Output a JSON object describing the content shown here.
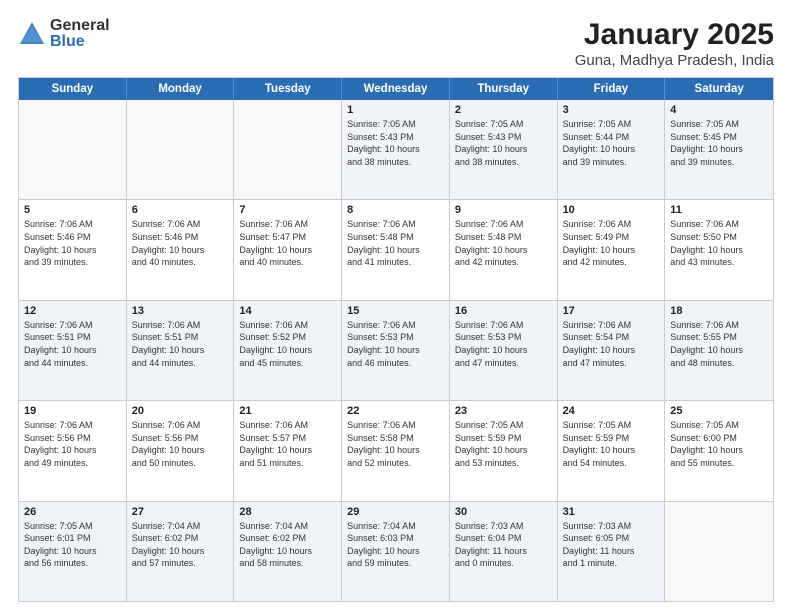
{
  "logo": {
    "general": "General",
    "blue": "Blue"
  },
  "title": "January 2025",
  "subtitle": "Guna, Madhya Pradesh, India",
  "header_days": [
    "Sunday",
    "Monday",
    "Tuesday",
    "Wednesday",
    "Thursday",
    "Friday",
    "Saturday"
  ],
  "rows": [
    [
      {
        "day": "",
        "info": ""
      },
      {
        "day": "",
        "info": ""
      },
      {
        "day": "",
        "info": ""
      },
      {
        "day": "1",
        "info": "Sunrise: 7:05 AM\nSunset: 5:43 PM\nDaylight: 10 hours\nand 38 minutes."
      },
      {
        "day": "2",
        "info": "Sunrise: 7:05 AM\nSunset: 5:43 PM\nDaylight: 10 hours\nand 38 minutes."
      },
      {
        "day": "3",
        "info": "Sunrise: 7:05 AM\nSunset: 5:44 PM\nDaylight: 10 hours\nand 39 minutes."
      },
      {
        "day": "4",
        "info": "Sunrise: 7:05 AM\nSunset: 5:45 PM\nDaylight: 10 hours\nand 39 minutes."
      }
    ],
    [
      {
        "day": "5",
        "info": "Sunrise: 7:06 AM\nSunset: 5:46 PM\nDaylight: 10 hours\nand 39 minutes."
      },
      {
        "day": "6",
        "info": "Sunrise: 7:06 AM\nSunset: 5:46 PM\nDaylight: 10 hours\nand 40 minutes."
      },
      {
        "day": "7",
        "info": "Sunrise: 7:06 AM\nSunset: 5:47 PM\nDaylight: 10 hours\nand 40 minutes."
      },
      {
        "day": "8",
        "info": "Sunrise: 7:06 AM\nSunset: 5:48 PM\nDaylight: 10 hours\nand 41 minutes."
      },
      {
        "day": "9",
        "info": "Sunrise: 7:06 AM\nSunset: 5:48 PM\nDaylight: 10 hours\nand 42 minutes."
      },
      {
        "day": "10",
        "info": "Sunrise: 7:06 AM\nSunset: 5:49 PM\nDaylight: 10 hours\nand 42 minutes."
      },
      {
        "day": "11",
        "info": "Sunrise: 7:06 AM\nSunset: 5:50 PM\nDaylight: 10 hours\nand 43 minutes."
      }
    ],
    [
      {
        "day": "12",
        "info": "Sunrise: 7:06 AM\nSunset: 5:51 PM\nDaylight: 10 hours\nand 44 minutes."
      },
      {
        "day": "13",
        "info": "Sunrise: 7:06 AM\nSunset: 5:51 PM\nDaylight: 10 hours\nand 44 minutes."
      },
      {
        "day": "14",
        "info": "Sunrise: 7:06 AM\nSunset: 5:52 PM\nDaylight: 10 hours\nand 45 minutes."
      },
      {
        "day": "15",
        "info": "Sunrise: 7:06 AM\nSunset: 5:53 PM\nDaylight: 10 hours\nand 46 minutes."
      },
      {
        "day": "16",
        "info": "Sunrise: 7:06 AM\nSunset: 5:53 PM\nDaylight: 10 hours\nand 47 minutes."
      },
      {
        "day": "17",
        "info": "Sunrise: 7:06 AM\nSunset: 5:54 PM\nDaylight: 10 hours\nand 47 minutes."
      },
      {
        "day": "18",
        "info": "Sunrise: 7:06 AM\nSunset: 5:55 PM\nDaylight: 10 hours\nand 48 minutes."
      }
    ],
    [
      {
        "day": "19",
        "info": "Sunrise: 7:06 AM\nSunset: 5:56 PM\nDaylight: 10 hours\nand 49 minutes."
      },
      {
        "day": "20",
        "info": "Sunrise: 7:06 AM\nSunset: 5:56 PM\nDaylight: 10 hours\nand 50 minutes."
      },
      {
        "day": "21",
        "info": "Sunrise: 7:06 AM\nSunset: 5:57 PM\nDaylight: 10 hours\nand 51 minutes."
      },
      {
        "day": "22",
        "info": "Sunrise: 7:06 AM\nSunset: 5:58 PM\nDaylight: 10 hours\nand 52 minutes."
      },
      {
        "day": "23",
        "info": "Sunrise: 7:05 AM\nSunset: 5:59 PM\nDaylight: 10 hours\nand 53 minutes."
      },
      {
        "day": "24",
        "info": "Sunrise: 7:05 AM\nSunset: 5:59 PM\nDaylight: 10 hours\nand 54 minutes."
      },
      {
        "day": "25",
        "info": "Sunrise: 7:05 AM\nSunset: 6:00 PM\nDaylight: 10 hours\nand 55 minutes."
      }
    ],
    [
      {
        "day": "26",
        "info": "Sunrise: 7:05 AM\nSunset: 6:01 PM\nDaylight: 10 hours\nand 56 minutes."
      },
      {
        "day": "27",
        "info": "Sunrise: 7:04 AM\nSunset: 6:02 PM\nDaylight: 10 hours\nand 57 minutes."
      },
      {
        "day": "28",
        "info": "Sunrise: 7:04 AM\nSunset: 6:02 PM\nDaylight: 10 hours\nand 58 minutes."
      },
      {
        "day": "29",
        "info": "Sunrise: 7:04 AM\nSunset: 6:03 PM\nDaylight: 10 hours\nand 59 minutes."
      },
      {
        "day": "30",
        "info": "Sunrise: 7:03 AM\nSunset: 6:04 PM\nDaylight: 11 hours\nand 0 minutes."
      },
      {
        "day": "31",
        "info": "Sunrise: 7:03 AM\nSunset: 6:05 PM\nDaylight: 11 hours\nand 1 minute."
      },
      {
        "day": "",
        "info": ""
      }
    ]
  ],
  "alt_rows": [
    0,
    2,
    4
  ]
}
